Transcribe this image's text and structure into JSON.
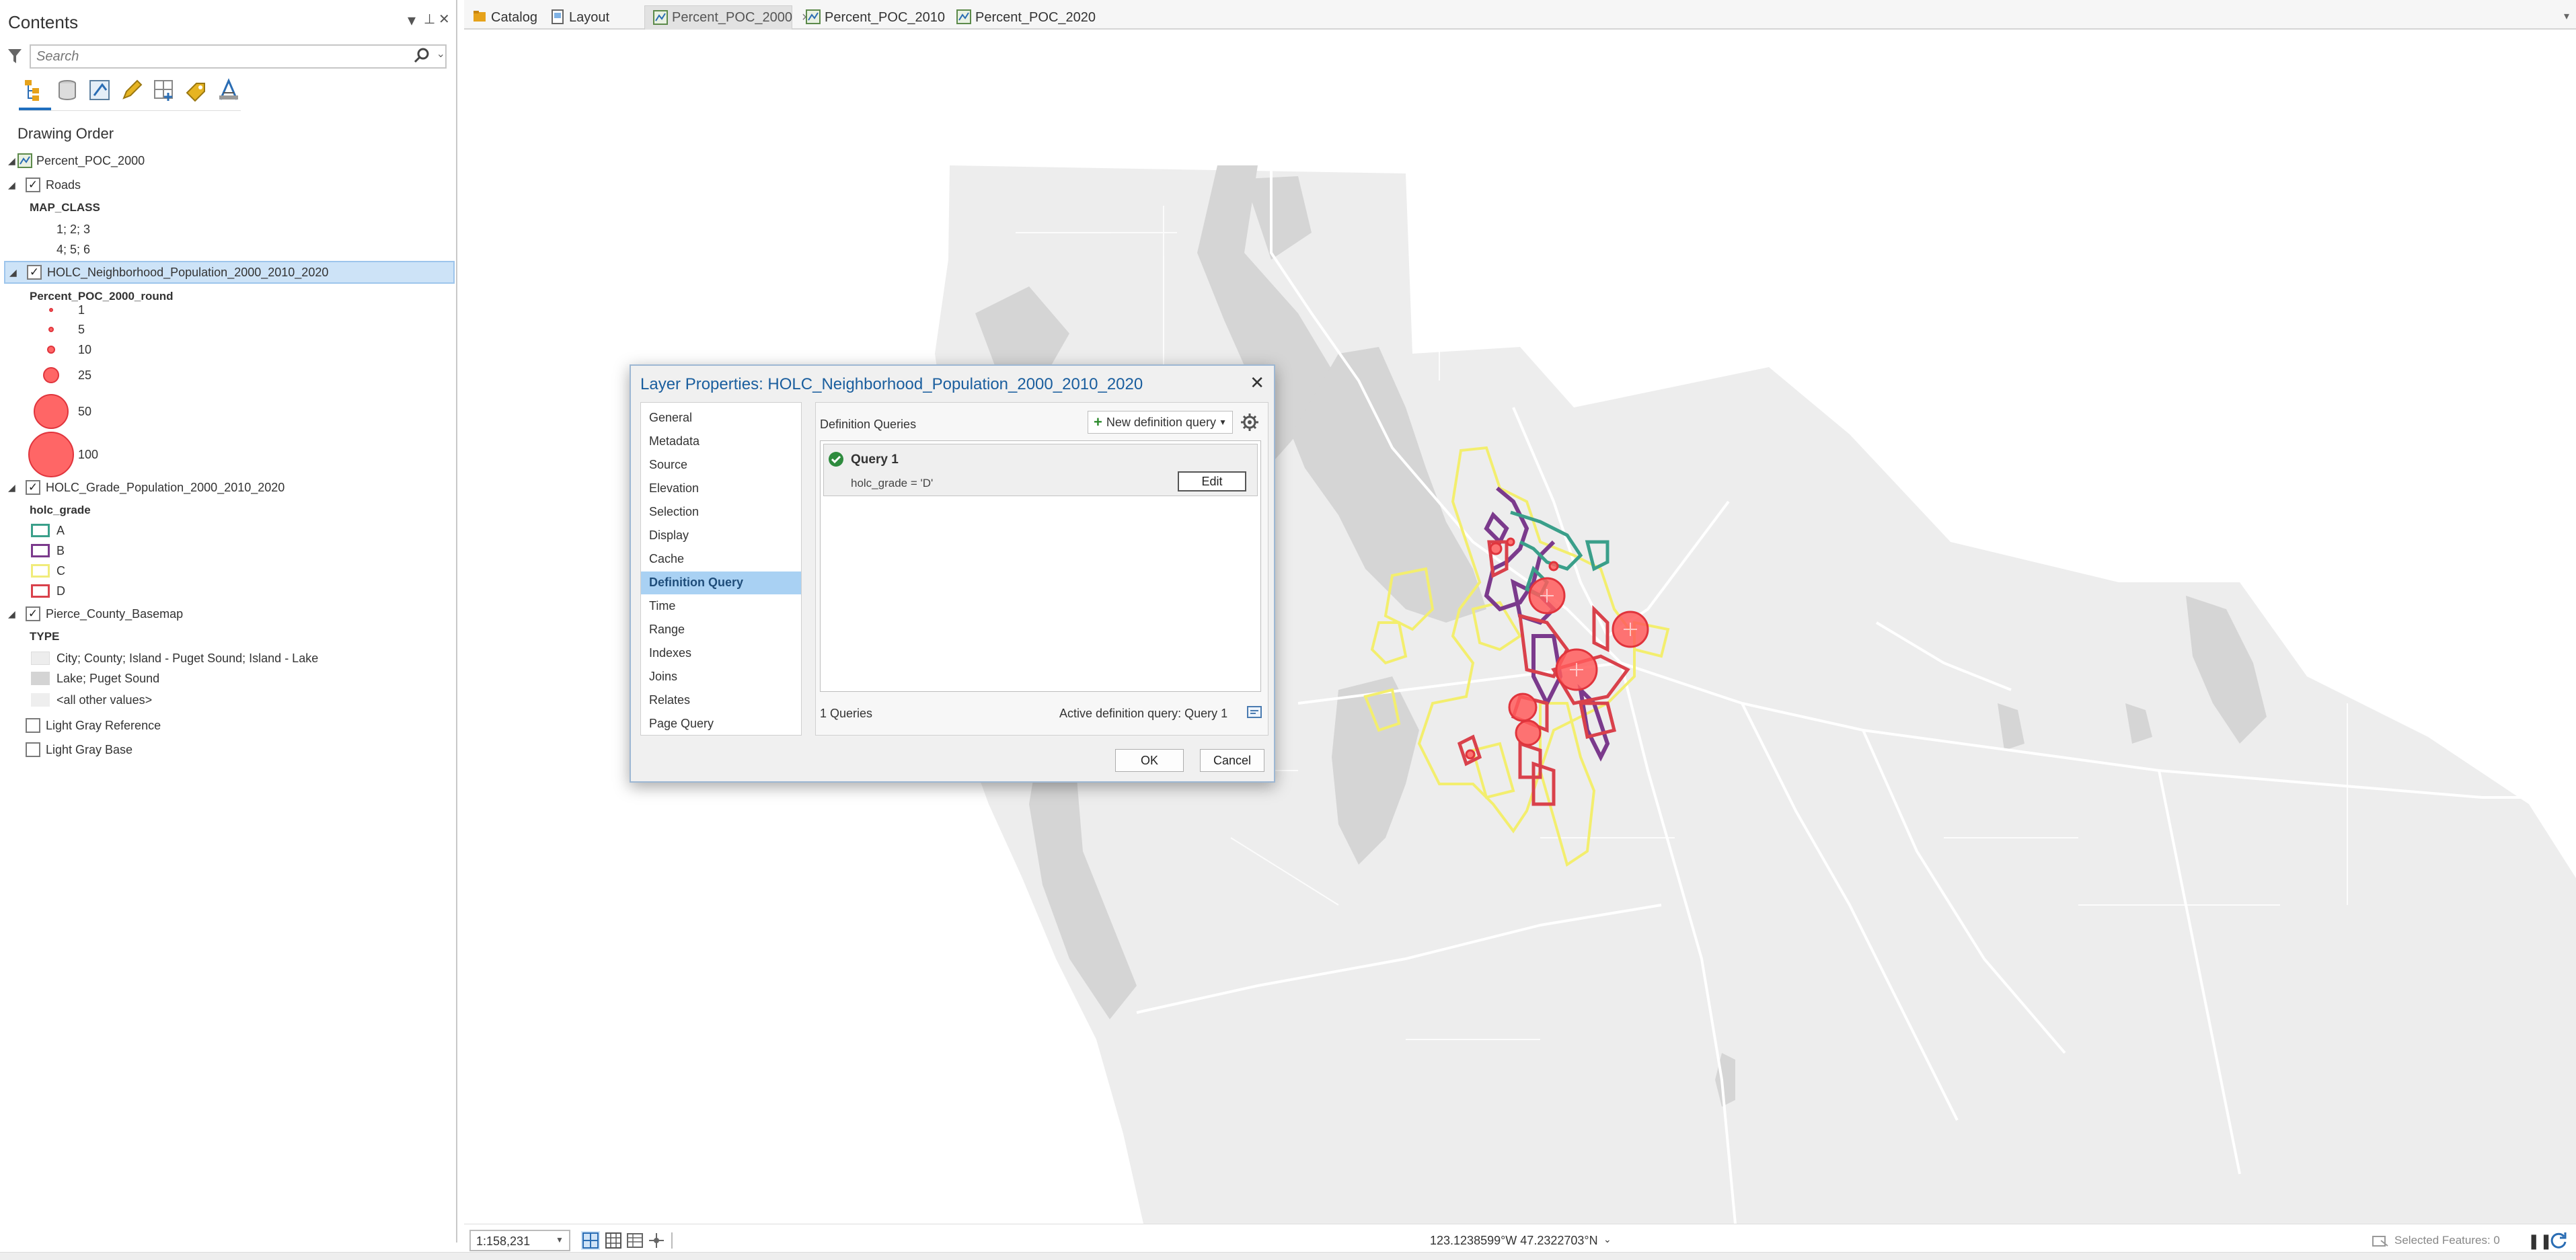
{
  "contents": {
    "title": "Contents",
    "pin_glyph": "▾",
    "autohide_glyph": "⊥",
    "close_glyph": "✕",
    "search": {
      "placeholder": "Search"
    },
    "toolbar_icons": [
      "list-by-drawing-order-icon",
      "list-by-source-icon",
      "list-by-selection-icon",
      "list-by-editing-icon",
      "list-by-snapping-icon",
      "list-by-labeling-icon",
      "list-by-perspective-imagery-icon"
    ],
    "drawing_order_label": "Drawing Order",
    "map_name": "Percent_POC_2000",
    "roads": {
      "name": "Roads",
      "checked": true,
      "field": "MAP_CLASS",
      "classes": [
        "1; 2; 3",
        "4; 5; 6"
      ]
    },
    "holc_neighborhood": {
      "name": "HOLC_Neighborhood_Population_2000_2010_2020",
      "checked": true,
      "field": "Percent_POC_2000_round",
      "classes": [
        "1",
        "5",
        "10",
        "25",
        "50",
        "100"
      ],
      "symbol_color": "#ff6666"
    },
    "holc_grade": {
      "name": "HOLC_Grade_Population_2000_2010_2020",
      "checked": true,
      "field": "holc_grade",
      "classes": [
        {
          "label": "A",
          "color": "#3a9f8a"
        },
        {
          "label": "B",
          "color": "#7b3a8c"
        },
        {
          "label": "C",
          "color": "#f0ec7a"
        },
        {
          "label": "D",
          "color": "#d9414b"
        }
      ]
    },
    "basemap": {
      "name": "Pierce_County_Basemap",
      "checked": true,
      "field": "TYPE",
      "classes": [
        {
          "label": "City; County; Island - Puget Sound; Island - Lake",
          "color": "#ededed"
        },
        {
          "label": "Lake; Puget Sound",
          "color": "#d4d4d4"
        },
        {
          "label": "<all other values>",
          "color": "#eeeeee"
        }
      ]
    },
    "light_gray_reference": {
      "name": "Light Gray Reference",
      "checked": false
    },
    "light_gray_base": {
      "name": "Light Gray Base",
      "checked": false
    }
  },
  "tabs": [
    {
      "label": "Catalog",
      "active": false,
      "closable": false
    },
    {
      "label": "Layout",
      "active": false,
      "closable": false
    },
    {
      "label": "Percent_POC_2000",
      "active": true,
      "closable": true
    },
    {
      "label": "Percent_POC_2010",
      "active": false,
      "closable": false
    },
    {
      "label": "Percent_POC_2020",
      "active": false,
      "closable": false
    }
  ],
  "tab_close_glyph": "×",
  "tab_overflow_glyph": "▾",
  "dialog": {
    "title": "Layer Properties: HOLC_Neighborhood_Population_2000_2010_2020",
    "close_glyph": "✕",
    "nav": [
      "General",
      "Metadata",
      "Source",
      "Elevation",
      "Selection",
      "Display",
      "Cache",
      "Definition Query",
      "Time",
      "Range",
      "Indexes",
      "Joins",
      "Relates",
      "Page Query"
    ],
    "selected_nav": "Definition Query",
    "panel_title": "Definition Queries",
    "new_query_label": "New definition query",
    "query": {
      "name": "Query 1",
      "expression": "holc_grade = 'D'",
      "edit_label": "Edit"
    },
    "query_count": "1 Queries",
    "active_query": "Active definition query: Query 1",
    "ok_label": "OK",
    "cancel_label": "Cancel"
  },
  "status": {
    "scale": "1:158,231",
    "coordinates": "123.1238599°W 47.2322703°N",
    "selected_features": "Selected Features: 0",
    "pause_glyph": "❚❚"
  },
  "colors": {
    "land": "#ededed",
    "water": "#d5d5d5",
    "holc_c": "#f3ee6e",
    "holc_b": "#7b3a8c",
    "holc_a": "#3a9f8a",
    "holc_d": "#d9414b",
    "poc_circle": "#ff5c5c"
  }
}
